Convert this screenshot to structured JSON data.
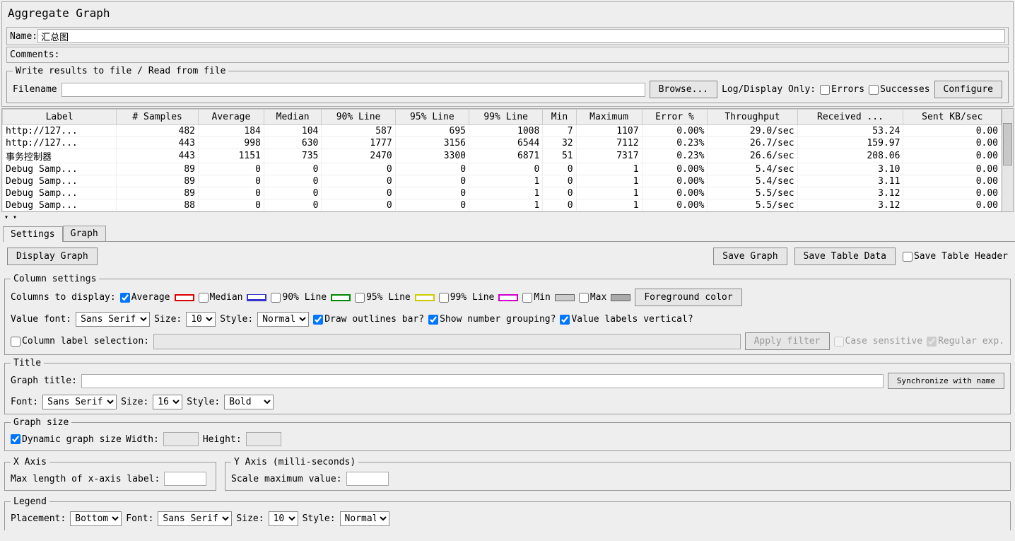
{
  "panelTitle": "Aggregate Graph",
  "nameLabel": "Name:",
  "nameValue": "汇总图",
  "commentsLabel": "Comments:",
  "fileSection": {
    "legend": "Write results to file / Read from file",
    "filenameLabel": "Filename",
    "browse": "Browse...",
    "logDisplayOnly": "Log/Display Only:",
    "errors": "Errors",
    "successes": "Successes",
    "configure": "Configure"
  },
  "table": {
    "headers": [
      "Label",
      "# Samples",
      "Average",
      "Median",
      "90% Line",
      "95% Line",
      "99% Line",
      "Min",
      "Maximum",
      "Error %",
      "Throughput",
      "Received ...",
      "Sent KB/sec"
    ],
    "rows": [
      [
        "http://127...",
        "482",
        "184",
        "104",
        "587",
        "695",
        "1008",
        "7",
        "1107",
        "0.00%",
        "29.0/sec",
        "53.24",
        "0.00"
      ],
      [
        "http://127...",
        "443",
        "998",
        "630",
        "1777",
        "3156",
        "6544",
        "32",
        "7112",
        "0.23%",
        "26.7/sec",
        "159.97",
        "0.00"
      ],
      [
        "事务控制器",
        "443",
        "1151",
        "735",
        "2470",
        "3300",
        "6871",
        "51",
        "7317",
        "0.23%",
        "26.6/sec",
        "208.06",
        "0.00"
      ],
      [
        "Debug Samp...",
        "89",
        "0",
        "0",
        "0",
        "0",
        "0",
        "0",
        "1",
        "0.00%",
        "5.4/sec",
        "3.10",
        "0.00"
      ],
      [
        "Debug Samp...",
        "89",
        "0",
        "0",
        "0",
        "0",
        "1",
        "0",
        "1",
        "0.00%",
        "5.4/sec",
        "3.11",
        "0.00"
      ],
      [
        "Debug Samp...",
        "89",
        "0",
        "0",
        "0",
        "0",
        "1",
        "0",
        "1",
        "0.00%",
        "5.5/sec",
        "3.12",
        "0.00"
      ],
      [
        "Debug Samp...",
        "88",
        "0",
        "0",
        "0",
        "0",
        "1",
        "0",
        "1",
        "0.00%",
        "5.5/sec",
        "3.12",
        "0.00"
      ]
    ]
  },
  "tabs": {
    "settings": "Settings",
    "graph": "Graph"
  },
  "buttons": {
    "displayGraph": "Display Graph",
    "saveGraph": "Save Graph",
    "saveTableData": "Save Table Data",
    "saveTableHeader": "Save Table Header",
    "foreground": "Foreground color",
    "applyFilter": "Apply filter",
    "syncName": "Synchronize with name"
  },
  "columnSettings": {
    "legend": "Column settings",
    "colsToDisplay": "Columns to display:",
    "average": "Average",
    "median": "Median",
    "line90": "90% Line",
    "line95": "95% Line",
    "line99": "99% Line",
    "min": "Min",
    "max": "Max",
    "valueFont": "Value font:",
    "size": "Size:",
    "style": "Style:",
    "drawOutlines": "Draw outlines bar?",
    "showGrouping": "Show number grouping?",
    "labelsVertical": "Value labels vertical?",
    "colLabelSel": "Column label selection:",
    "caseSensitive": "Case sensitive",
    "regex": "Regular exp.",
    "fontVal": "Sans Serif",
    "sizeVal": "10",
    "styleVal": "Normal"
  },
  "titleSection": {
    "legend": "Title",
    "graphTitle": "Graph title:",
    "font": "Font:",
    "size": "Size:",
    "style": "Style:",
    "fontVal": "Sans Serif",
    "sizeVal": "16",
    "styleVal": "Bold"
  },
  "graphSize": {
    "legend": "Graph size",
    "dynamic": "Dynamic graph size",
    "width": "Width:",
    "height": "Height:"
  },
  "xaxis": {
    "legend": "X Axis",
    "maxLen": "Max length of x-axis label:"
  },
  "yaxis": {
    "legend": "Y Axis (milli-seconds)",
    "scaleMax": "Scale maximum value:"
  },
  "legendSection": {
    "legend": "Legend",
    "placement": "Placement:",
    "placementVal": "Bottom",
    "font": "Font:",
    "fontVal": "Sans Serif",
    "size": "Size:",
    "sizeVal": "10",
    "style": "Style:",
    "styleVal": "Normal"
  }
}
